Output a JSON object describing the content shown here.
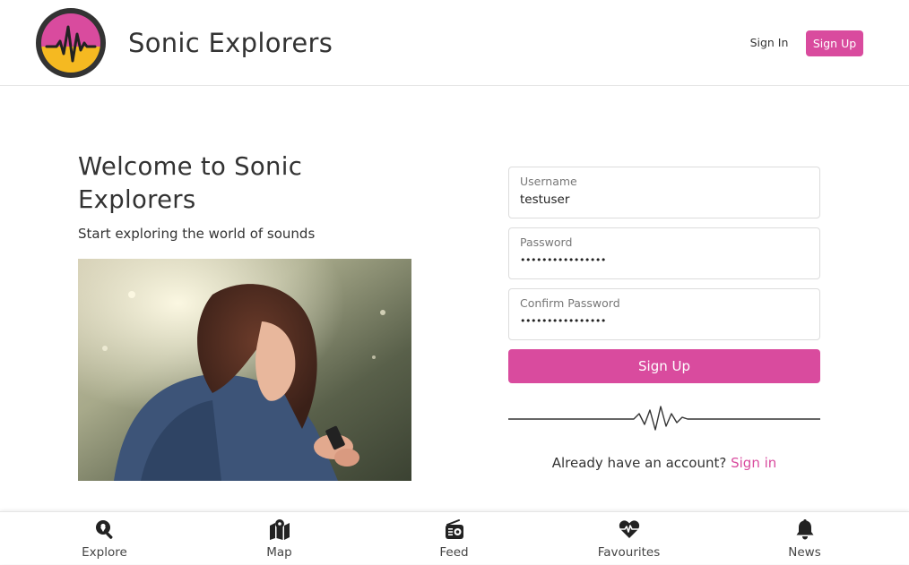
{
  "header": {
    "brand": "Sonic Explorers",
    "signin_label": "Sign In",
    "signup_label": "Sign Up",
    "logo_icon": "sound-wave-logo-icon"
  },
  "hero": {
    "title": "Welcome to Sonic Explorers",
    "subtitle": "Start exploring the world of sounds"
  },
  "form": {
    "username": {
      "label": "Username",
      "value": "testuser"
    },
    "password": {
      "label": "Password",
      "value": "••••••••••••••••"
    },
    "confirm": {
      "label": "Confirm Password",
      "value": "••••••••••••••••"
    },
    "submit_label": "Sign Up",
    "already_text": "Already have an account?",
    "signin_link": "Sign in"
  },
  "nav": {
    "items": [
      {
        "label": "Explore",
        "icon": "search-location-icon"
      },
      {
        "label": "Map",
        "icon": "map-icon"
      },
      {
        "label": "Feed",
        "icon": "radio-icon"
      },
      {
        "label": "Favourites",
        "icon": "heartbeat-icon"
      },
      {
        "label": "News",
        "icon": "bell-icon"
      }
    ]
  },
  "colors": {
    "accent": "#d94b9e",
    "logo_ring": "#333333",
    "logo_top": "#d94b9e",
    "logo_bottom": "#f5b921"
  }
}
